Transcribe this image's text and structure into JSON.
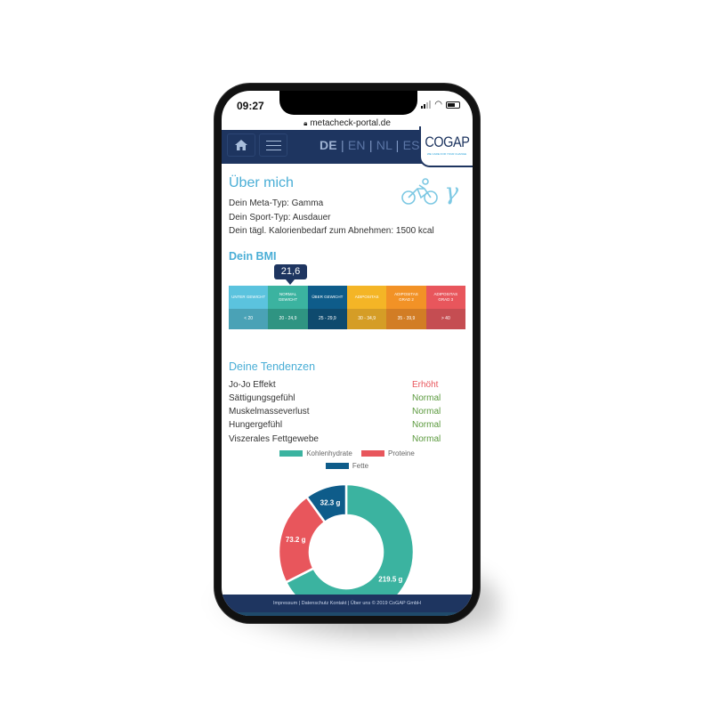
{
  "status_bar": {
    "time": "09:27"
  },
  "browser": {
    "url": "metacheck-portal.de"
  },
  "nav": {
    "languages": [
      {
        "code": "DE",
        "active": true
      },
      {
        "code": "EN",
        "active": false
      },
      {
        "code": "NL",
        "active": false
      },
      {
        "code": "ES",
        "active": false
      }
    ],
    "separator": "|",
    "logo": {
      "name": "COGAP",
      "tagline": "WE CARE FOR YOUR CHANGE"
    }
  },
  "about": {
    "title": "Über mich",
    "lines": [
      "Dein Meta-Typ: Gamma",
      "Dein Sport-Typ: Ausdauer",
      "Dein tägl. Kalorienbedarf zum Abnehmen: 1500 kcal"
    ],
    "icons": [
      "bicycle-icon",
      "gamma-icon"
    ],
    "gamma_symbol": "γ"
  },
  "bmi": {
    "title": "Dein BMI",
    "value": "21,6",
    "active_index": 1,
    "categories": [
      {
        "label": "UNTER GEWICHT",
        "range": "< 20",
        "color": "#5bc3de",
        "dark": "#4aa2b6"
      },
      {
        "label": "NORMAL GEWICHT",
        "range": "20 - 24,9",
        "color": "#3bb3a0",
        "dark": "#2f9482"
      },
      {
        "label": "ÜBER GEWICHT",
        "range": "25 - 29,9",
        "color": "#0e5c8a",
        "dark": "#0e4a6e"
      },
      {
        "label": "ADIPOSITAS",
        "range": "30 - 34,9",
        "color": "#f4b526",
        "dark": "#d59d26"
      },
      {
        "label": "ADIPOSITAS GRAD 2",
        "range": "35 - 39,9",
        "color": "#f29226",
        "dark": "#d27d25"
      },
      {
        "label": "ADIPOSITAS GRAD 3",
        "range": "> 40",
        "color": "#e8565c",
        "dark": "#c54d52"
      }
    ]
  },
  "tendencies": {
    "title": "Deine Tendenzen",
    "rows": [
      {
        "label": "Jo-Jo Effekt",
        "value": "Erhöht",
        "status": "high",
        "color": "#e8565c"
      },
      {
        "label": "Sättigungsgefühl",
        "value": "Normal",
        "status": "normal",
        "color": "#5b9a3e"
      },
      {
        "label": "Muskelmasseverlust",
        "value": "Normal",
        "status": "normal",
        "color": "#5b9a3e"
      },
      {
        "label": "Hungergefühl",
        "value": "Normal",
        "status": "normal",
        "color": "#5b9a3e"
      },
      {
        "label": "Viszerales Fettgewebe",
        "value": "Normal",
        "status": "normal",
        "color": "#5b9a3e"
      }
    ]
  },
  "chart_data": {
    "type": "pie",
    "variant": "donut",
    "title": "",
    "unit": "g",
    "categories": [
      "Kohlenhydrate",
      "Proteine",
      "Fette"
    ],
    "values": [
      219.5,
      73.2,
      32.3
    ],
    "labels": [
      "219.5 g",
      "73.2 g",
      "32.3 g"
    ],
    "colors": [
      "#3bb3a0",
      "#e8565c",
      "#0e5c8a"
    ],
    "legend_position": "top"
  },
  "footer": {
    "text": "Impressum | Datenschutz Kontakt | Über uns © 2019 CoGAP GmbH"
  }
}
